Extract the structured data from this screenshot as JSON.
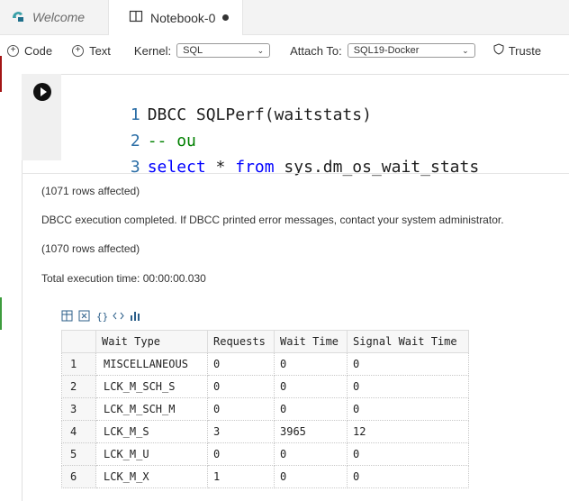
{
  "tabs": [
    {
      "label": "Welcome",
      "icon": "azure-data-studio-icon",
      "active": false
    },
    {
      "label": "Notebook-0",
      "icon": "notebook-icon",
      "active": true,
      "dirty": true
    }
  ],
  "toolbar": {
    "code_label": "Code",
    "text_label": "Text",
    "kernel_label": "Kernel:",
    "kernel_value": "SQL",
    "attach_label": "Attach To:",
    "attach_value": "SQL19-Docker",
    "trusted_label": "Truste"
  },
  "cell": {
    "lines": [
      {
        "num": "1",
        "segments": [
          {
            "text": "DBCC SQLPerf(waitstats)",
            "kind": "plain"
          }
        ]
      },
      {
        "num": "2",
        "segments": [
          {
            "text": "-- ou",
            "kind": "cmt"
          }
        ]
      },
      {
        "num": "3",
        "segments": [
          {
            "text": "select",
            "kind": "kw"
          },
          {
            "text": " * ",
            "kind": "plain"
          },
          {
            "text": "from",
            "kind": "kw"
          },
          {
            "text": " sys.dm_os_wait_stats",
            "kind": "plain"
          }
        ]
      }
    ]
  },
  "output": {
    "messages": [
      "(1071 rows affected)",
      "DBCC execution completed. If DBCC printed error messages, contact your system administrator.",
      "(1070 rows affected)",
      "Total execution time: 00:00:00.030"
    ],
    "grid_actions": [
      "save-csv-icon",
      "save-excel-icon",
      "save-json-icon",
      "save-xml-icon",
      "chart-icon"
    ],
    "columns": [
      "",
      "Wait Type",
      "Requests",
      "Wait Time",
      "Signal Wait Time"
    ],
    "rows": [
      [
        "1",
        "MISCELLANEOUS",
        "0",
        "0",
        "0"
      ],
      [
        "2",
        "LCK_M_SCH_S",
        "0",
        "0",
        "0"
      ],
      [
        "3",
        "LCK_M_SCH_M",
        "0",
        "0",
        "0"
      ],
      [
        "4",
        "LCK_M_S",
        "3",
        "3965",
        "12"
      ],
      [
        "5",
        "LCK_M_U",
        "0",
        "0",
        "0"
      ],
      [
        "6",
        "LCK_M_X",
        "1",
        "0",
        "0"
      ]
    ]
  }
}
